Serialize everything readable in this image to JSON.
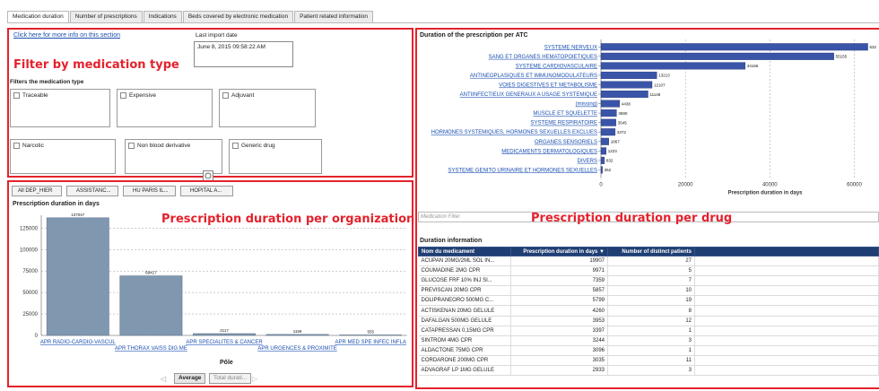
{
  "tabs": [
    {
      "label": "Medication duration",
      "active": true
    },
    {
      "label": "Number of prescriptions",
      "active": false
    },
    {
      "label": "Indications",
      "active": false
    },
    {
      "label": "Beds covered by electronic medication",
      "active": false
    },
    {
      "label": "Patient related information",
      "active": false
    }
  ],
  "filter_panel": {
    "info_link": "Click here for more info on this section",
    "last_import_label": "Last import date",
    "last_import_value": "June 8, 2015 09:58:22 AM",
    "annotation": "Filter by medication type",
    "section_label": "Filters the medication type",
    "checkboxes": [
      "Traceable",
      "Expensive",
      "Adjuvant",
      "Narcotic",
      "Non blood derivative",
      "Generic drug"
    ]
  },
  "org_panel": {
    "annotation": "Prescription duration per organization",
    "breadcrumb": [
      "All DEP_HIER",
      "ASSISTANC...",
      "HU PARIS IL...",
      "HOPITAL A..."
    ],
    "chart_title": "Prescription duration in days",
    "xlabel": "Pôle",
    "buttons": {
      "average": "Average",
      "total": "Total durati..."
    }
  },
  "drug_panel": {
    "chart_title": "Duration of the prescription per ATC",
    "annotation": "Prescription duration per drug",
    "filter_placeholder": "Medication Filter",
    "duration_title": "Duration information",
    "table_headers": [
      "Nom du medicament",
      "Prescription duration in days",
      "Number of distinct patients"
    ],
    "sort_glyph": "▼",
    "rows": [
      [
        "ACUPAN 20MG/2ML SOL IN...",
        "19907",
        "27"
      ],
      [
        "COUMADINE 2MG CPR",
        "9971",
        "5"
      ],
      [
        "GLUCOSE FRF 10% INJ SI...",
        "7359",
        "7"
      ],
      [
        "PREVISCAN 20MG CPR",
        "5857",
        "10"
      ],
      [
        "DOLIPRANEORO 500MG C...",
        "5799",
        "19"
      ],
      [
        "ACTISKENAN 20MG GELULE",
        "4260",
        "8"
      ],
      [
        "DAFALGAN 500MG GELULE",
        "3953",
        "12"
      ],
      [
        "CATAPRESSAN 0,15MG CPR",
        "3397",
        "1"
      ],
      [
        "SINTROM 4MG CPR",
        "3244",
        "3"
      ],
      [
        "ALDACTONE 75MG CPR",
        "3096",
        "1"
      ],
      [
        "CORDARONE 200MG CPR",
        "3035",
        "11"
      ],
      [
        "ADVAGRAF LP 1MG GELULE",
        "2933",
        "3"
      ]
    ]
  },
  "colors": {
    "annotation_red": "#e4222c",
    "org_bar": "#8097b0",
    "atc_bar": "#3a55a8",
    "table_header": "#1f3f73",
    "link": "#1a4fb0"
  },
  "chart_data": [
    {
      "type": "bar",
      "title": "Prescription duration in days",
      "xlabel": "Pôle",
      "ylabel": "",
      "categories": [
        "APR RADIO-CARDIO-VASCUL",
        "APR THORAX VAISS DIG ME",
        "APR SPECIALITES & CANCER",
        "APR URGENCES & PROXIMITE",
        "APR MED SPE INFEC INFLA"
      ],
      "values": [
        137047,
        69417,
        2117,
        1159,
        555
      ],
      "value_labels": [
        "137047",
        "69417",
        "2117",
        "1159",
        "555"
      ],
      "ylim": [
        0,
        140000
      ],
      "yticks": [
        0,
        25000,
        50000,
        75000,
        100000,
        125000
      ],
      "ytick_labels": [
        "0",
        "25000",
        "50000",
        "75000",
        "100000",
        "125000"
      ],
      "grid": true
    },
    {
      "type": "bar",
      "orientation": "horizontal",
      "title": "Duration of the prescription per ATC",
      "xlabel": "Prescription duration in days",
      "categories": [
        "SYSTEME NERVEUX",
        "SANG ET ORGANES HEMATOPOIETIQUES",
        "SYSTEME CARDIOVASCULAIRE",
        "ANTINEOPLASIQUES ET IMMUNOMODULATEURS",
        "VOIES DIGESTIVES ET METABOLISME",
        "ANTIINFECTIEUX GENERAUX A USAGE SYSTEMIQUE",
        "(missing)",
        "MUSCLE ET SQUELETTE",
        "SYSTEME RESPIRATOIRE",
        "HORMONES SYSTEMIQUES, HORMONES SEXUELLES EXCLUES",
        "ORGANES SENSORIELS",
        "MEDICAMENTS DERMATOLOGIQUES",
        "DIVERS",
        "SYSTEME GENITO URINAIRE ET HORMONES SEXUELLES"
      ],
      "values": [
        63200,
        55155,
        34166,
        13213,
        12107,
        11148,
        4438,
        3690,
        3545,
        3372,
        1867,
        1223,
        832,
        352
      ],
      "value_labels": [
        "632",
        "55155",
        "34166",
        "13213",
        "12107",
        "11148",
        "4438",
        "3690",
        "3545",
        "3372",
        "1867",
        "1223",
        "832",
        "352"
      ],
      "xlim": [
        0,
        65000
      ],
      "xticks": [
        0,
        20000,
        40000,
        60000
      ],
      "xtick_labels": [
        "0",
        "20000",
        "40000",
        "60000"
      ],
      "grid": true
    }
  ]
}
